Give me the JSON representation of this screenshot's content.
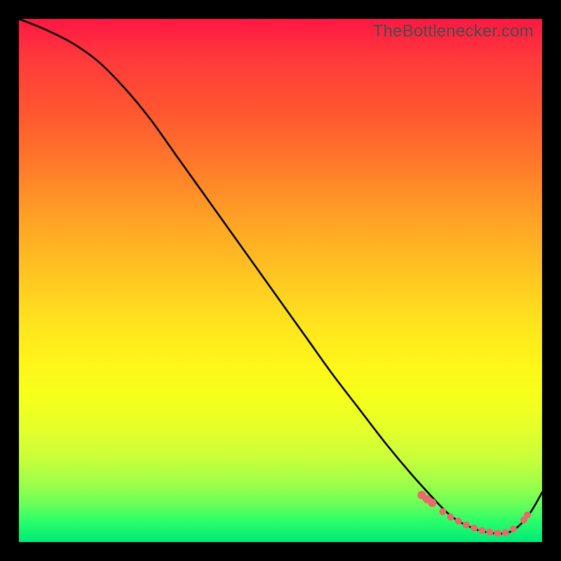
{
  "watermark": "TheBottlenecker.com",
  "chart_data": {
    "type": "line",
    "title": "",
    "xlabel": "",
    "ylabel": "",
    "xlim": [
      0,
      100
    ],
    "ylim": [
      0,
      100
    ],
    "series": [
      {
        "name": "bottleneck-curve",
        "x": [
          0,
          5,
          10,
          15,
          20,
          25,
          30,
          35,
          40,
          45,
          50,
          55,
          60,
          65,
          70,
          75,
          80,
          82,
          84,
          86,
          88,
          90,
          92,
          94,
          96,
          98,
          100
        ],
        "y": [
          100,
          98,
          95.5,
          92,
          87,
          81,
          74,
          67,
          60,
          53,
          46,
          39,
          32,
          25.5,
          19,
          13,
          7.5,
          5.5,
          4,
          3,
          2.2,
          1.8,
          1.6,
          2.0,
          3.5,
          6.0,
          9.5
        ]
      }
    ],
    "markers": {
      "name": "highlighted-points",
      "color": "#e96a6a",
      "points": [
        {
          "x": 77,
          "y": 9.0,
          "r": 6
        },
        {
          "x": 78,
          "y": 8.2,
          "r": 6
        },
        {
          "x": 79,
          "y": 7.5,
          "r": 6
        },
        {
          "x": 81,
          "y": 5.8,
          "r": 5
        },
        {
          "x": 82.5,
          "y": 4.8,
          "r": 5
        },
        {
          "x": 84,
          "y": 4.0,
          "r": 5
        },
        {
          "x": 85.5,
          "y": 3.3,
          "r": 5
        },
        {
          "x": 87,
          "y": 2.7,
          "r": 5
        },
        {
          "x": 88.5,
          "y": 2.2,
          "r": 5
        },
        {
          "x": 90,
          "y": 1.9,
          "r": 5
        },
        {
          "x": 91.5,
          "y": 1.7,
          "r": 5
        },
        {
          "x": 93,
          "y": 1.8,
          "r": 5
        },
        {
          "x": 94.5,
          "y": 2.5,
          "r": 5
        },
        {
          "x": 96.5,
          "y": 4.2,
          "r": 5
        },
        {
          "x": 97.2,
          "y": 5.2,
          "r": 5
        }
      ]
    }
  }
}
